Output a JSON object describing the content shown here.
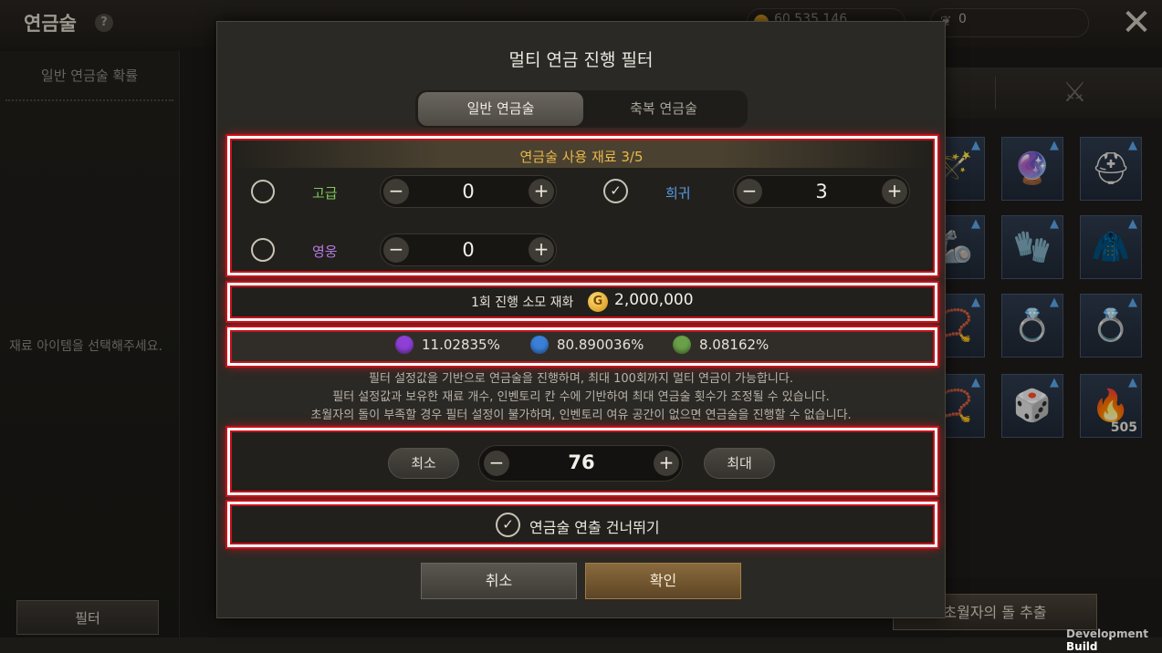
{
  "background": {
    "title": "연금술",
    "help_icon": "?",
    "left_tab": "일반 연금술 확률",
    "left_hint": "재료 아이템을 선택해주세요.",
    "filter_button": "필터",
    "gold_amount": "60,535,146",
    "stone_count": "0",
    "extract_button": "초월자의 돌 추출",
    "dev_build": "Development Build",
    "inventory_slots": [
      {
        "icon": "staff-icon",
        "glyph": "🪄",
        "upgrade": true,
        "count": ""
      },
      {
        "icon": "orb-icon",
        "glyph": "🔮",
        "upgrade": true,
        "count": ""
      },
      {
        "icon": "helmet-icon",
        "glyph": "⛑",
        "upgrade": true,
        "count": ""
      },
      {
        "icon": "gauntlet-icon",
        "glyph": "🦾",
        "upgrade": true,
        "count": ""
      },
      {
        "icon": "glove-icon",
        "glyph": "🧤",
        "upgrade": true,
        "count": ""
      },
      {
        "icon": "cloak-icon",
        "glyph": "🧥",
        "upgrade": true,
        "count": ""
      },
      {
        "icon": "necklace-icon",
        "glyph": "📿",
        "upgrade": true,
        "count": ""
      },
      {
        "icon": "ring-icon",
        "glyph": "💍",
        "upgrade": true,
        "count": ""
      },
      {
        "icon": "emerald-ring-icon",
        "glyph": "💍",
        "upgrade": true,
        "count": ""
      },
      {
        "icon": "amulet-icon",
        "glyph": "📿",
        "upgrade": true,
        "count": ""
      },
      {
        "icon": "stone-icon",
        "glyph": "🎲",
        "upgrade": true,
        "count": ""
      },
      {
        "icon": "fire-stone-icon",
        "glyph": "🔥",
        "upgrade": true,
        "count": "505"
      }
    ]
  },
  "modal": {
    "title": "멀티 연금 진행 필터",
    "tabs": {
      "normal": "일반 연금술",
      "blessed": "축복 연금술"
    },
    "materials_header": "연금술 사용 재료 3/5",
    "materials": [
      {
        "grade": "고급",
        "color": "#7ec95a",
        "checked": false,
        "value": "0"
      },
      {
        "grade": "희귀",
        "color": "#5a9ee8",
        "checked": true,
        "value": "3"
      },
      {
        "grade": "영웅",
        "color": "#b67be6",
        "checked": false,
        "value": "0"
      }
    ],
    "cost_label": "1회 진행 소모 재화",
    "cost_value": "2,000,000",
    "coin_glyph": "G",
    "probabilities": [
      {
        "color": "#8e3fd6",
        "value": "11.02835%"
      },
      {
        "color": "#3a7fd8",
        "value": "80.890036%"
      },
      {
        "color": "#6aa048",
        "value": "8.08162%"
      }
    ],
    "descriptions": [
      "필터 설정값을 기반으로 연금술을 진행하며, 최대 100회까지 멀티 연금이 가능합니다.",
      "필터 설정값과 보유한 재료 개수, 인벤토리 칸 수에 기반하여 최대 연금술 횟수가 조정될 수 있습니다.",
      "초월자의 돌이 부족할 경우 필터 설정이 불가하며, 인벤토리 여유 공간이 없으면 연금술을 진행할 수 없습니다."
    ],
    "min_label": "최소",
    "max_label": "최대",
    "count_value": "76",
    "skip_label": "연금술 연출 건너뛰기",
    "cancel_label": "취소",
    "confirm_label": "확인",
    "minus_glyph": "−",
    "plus_glyph": "+",
    "check_glyph": "✓"
  }
}
